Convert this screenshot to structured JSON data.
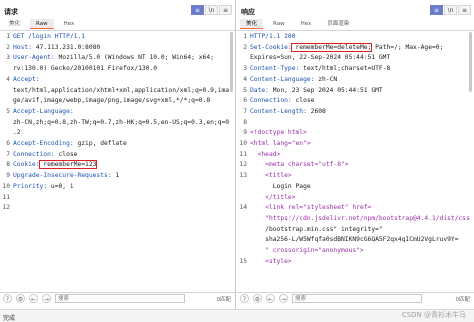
{
  "request": {
    "title": "请求",
    "tabs": [
      "美化",
      "Raw",
      "Hex"
    ],
    "active_tab": 1,
    "toolbar": [
      "≡",
      "\\n",
      "≡"
    ],
    "lines": [
      {
        "n": "1",
        "k": "GET /login HTTP/1.1",
        "v": ""
      },
      {
        "n": "2",
        "k": "Host:",
        "v": " 47.113.231.0:8080"
      },
      {
        "n": "3",
        "k": "User-Agent:",
        "v": " Mozilla/5.0 (Windows NT 10.0; Win64; x64;"
      },
      {
        "n": "",
        "k": "",
        "v": "rv:130.0) Gecko/20100101 Firefox/130.0"
      },
      {
        "n": "4",
        "k": "Accept:",
        "v": ""
      },
      {
        "n": "",
        "k": "",
        "v": "text/html,application/xhtml+xml,application/xml;q=0.9,ima"
      },
      {
        "n": "",
        "k": "",
        "v": "ge/avif,image/webp,image/png,image/svg+xml,*/*;q=0.8"
      },
      {
        "n": "5",
        "k": "Accept-Language:",
        "v": ""
      },
      {
        "n": "",
        "k": "",
        "v": "zh-CN,zh;q=0.8,zh-TW;q=0.7,zh-HK;q=0.5,en-US;q=0.3,en;q=0"
      },
      {
        "n": "",
        "k": "",
        "v": ".2"
      },
      {
        "n": "6",
        "k": "Accept-Encoding:",
        "v": " gzip, deflate"
      },
      {
        "n": "7",
        "k": "Connection:",
        "v": " close"
      },
      {
        "n": "8",
        "k": "Cookie:",
        "v": " rememberMe=123"
      },
      {
        "n": "9",
        "k": "Upgrade-Insecure-Requests:",
        "v": " 1"
      },
      {
        "n": "10",
        "k": "Priority:",
        "v": " u=0, i"
      },
      {
        "n": "11",
        "k": "",
        "v": ""
      },
      {
        "n": "12",
        "k": "",
        "v": ""
      }
    ],
    "search_placeholder": "搜索",
    "match_text": "0匹配"
  },
  "response": {
    "title": "响应",
    "tabs": [
      "美化",
      "Raw",
      "Hex",
      "页面渲染"
    ],
    "active_tab": 0,
    "toolbar": [
      "≡",
      "\\n",
      "≡"
    ],
    "lines": [
      {
        "n": "1",
        "k": "HTTP/1.1 200",
        "v": ""
      },
      {
        "n": "2",
        "k": "Set-Cookie:",
        "v": " rememberMe=deleteMe; Path=/; Max-Age=0;"
      },
      {
        "n": "",
        "k": "",
        "v": "Expires=Sun, 22-Sep-2024 05:44:51 GMT"
      },
      {
        "n": "3",
        "k": "Content-Type:",
        "v": " text/html;charset=UTF-8"
      },
      {
        "n": "4",
        "k": "Content-Language:",
        "v": " zh-CN"
      },
      {
        "n": "5",
        "k": "Date:",
        "v": " Mon, 23 Sep 2024 05:44:51 GMT"
      },
      {
        "n": "6",
        "k": "Connection:",
        "v": " close"
      },
      {
        "n": "7",
        "k": "Content-Length:",
        "v": " 2608"
      },
      {
        "n": "8",
        "k": "",
        "v": ""
      },
      {
        "n": "9",
        "k": "",
        "v": "<!doctype html>"
      },
      {
        "n": "10",
        "k": "",
        "v": "<html lang=\"en\">"
      },
      {
        "n": "11",
        "k": "",
        "v": "  <head>"
      },
      {
        "n": "12",
        "k": "",
        "v": "    <meta charset=\"utf-8\">"
      },
      {
        "n": "13",
        "k": "",
        "v": "    <title>"
      },
      {
        "n": "",
        "k": "",
        "v": "      Login Page"
      },
      {
        "n": "",
        "k": "",
        "v": "    </title>"
      },
      {
        "n": "14",
        "k": "",
        "v": "    <link rel=\"stylesheet\" href="
      },
      {
        "n": "",
        "k": "",
        "v": "    \"https://cdn.jsdelivr.net/npm/bootstrap@4.4.1/dist/css"
      },
      {
        "n": "",
        "k": "",
        "v": "    /bootstrap.min.css\" integrity=\""
      },
      {
        "n": "",
        "k": "",
        "v": "    sha256-L/W5Wfqfa0sdBNIKN9cG6QA5F2qx4qICmU2VgLruv9Y="
      },
      {
        "n": "",
        "k": "",
        "v": "    \" crossorigin=\"anonymous\">"
      },
      {
        "n": "15",
        "k": "",
        "v": "    <style>"
      }
    ],
    "search_placeholder": "搜索",
    "match_text": "0匹配"
  },
  "status": {
    "text": "完成"
  },
  "watermark": "CSDN @青衫木牛马"
}
